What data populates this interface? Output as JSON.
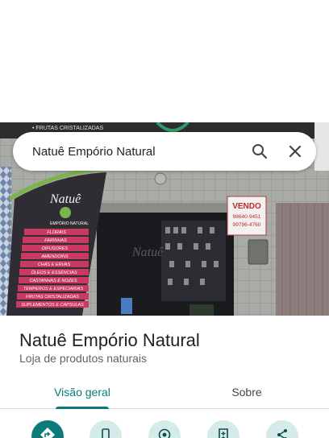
{
  "search": {
    "query": "Natuê Empório Natural"
  },
  "place": {
    "name": "Natuê Empório Natural",
    "category": "Loja de produtos naturais"
  },
  "tabs": [
    {
      "label": "Visão geral",
      "active": true
    },
    {
      "label": "Sobre",
      "active": false
    }
  ],
  "photo": {
    "banner_lines": [
      "• FRUTAS CRISTALIZADAS"
    ],
    "store_logo": "Natuê",
    "store_subtitle": "EMPÓRIO NATURAL",
    "product_list": [
      "FLORAIS",
      "FARINHAS",
      "DIFUSORES",
      "AMENDOINS",
      "CHÁS E ERVAS",
      "ÓLEOS E ESSÊNCIAS",
      "CASTANHAS E NOZES",
      "TEMPEROS E ESPECIARIAS",
      "FRUTAS CRISTALIZADAS",
      "SUPLEMENTOS E CÁPSULAS"
    ],
    "sale_sign_title": "VENDO",
    "sale_sign_phone_1": "98640-9451",
    "sale_sign_phone_2": "99796-4760"
  },
  "actions": [
    {
      "icon": "directions-icon",
      "primary": true
    },
    {
      "icon": "phone-icon",
      "primary": false
    },
    {
      "icon": "location-icon",
      "primary": false
    },
    {
      "icon": "save-icon",
      "primary": false
    },
    {
      "icon": "share-icon",
      "primary": false
    }
  ],
  "colors": {
    "accent": "#0b7a78",
    "accent_light": "#d5ebe9",
    "text": "#202124",
    "secondary_text": "#5f6368"
  }
}
